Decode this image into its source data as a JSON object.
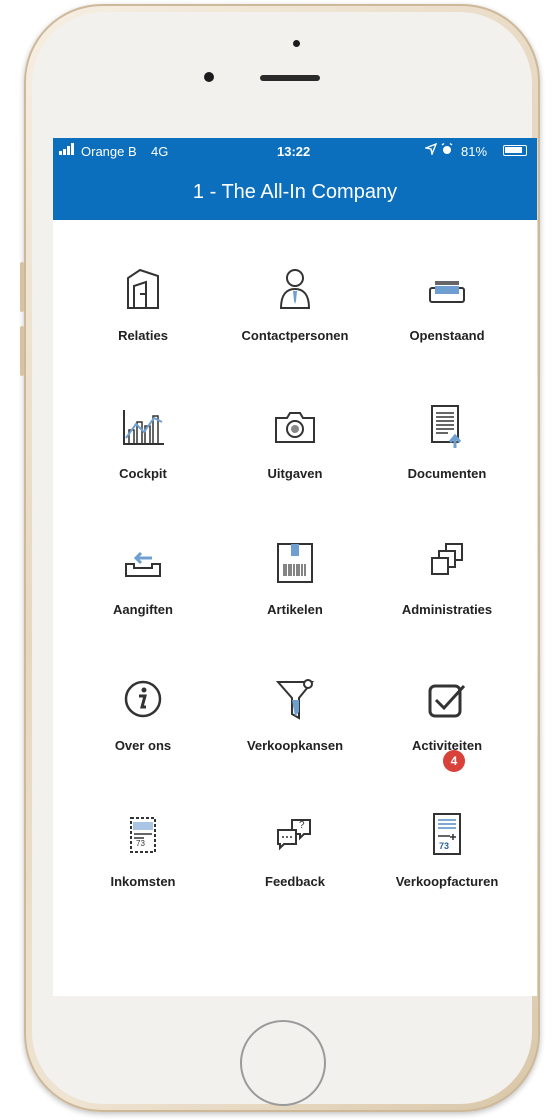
{
  "status": {
    "carrier": "Orange B",
    "network": "4G",
    "time": "13:22",
    "battery": "81%"
  },
  "header": {
    "title": "1 - The All-In Company"
  },
  "menu": [
    {
      "label": "Relaties",
      "icon": "building-icon"
    },
    {
      "label": "Contactpersonen",
      "icon": "person-icon"
    },
    {
      "label": "Openstaand",
      "icon": "tray-stack-icon"
    },
    {
      "label": "Cockpit",
      "icon": "chart-icon"
    },
    {
      "label": "Uitgaven",
      "icon": "camera-icon"
    },
    {
      "label": "Documenten",
      "icon": "document-upload-icon"
    },
    {
      "label": "Aangiften",
      "icon": "outbox-icon"
    },
    {
      "label": "Artikelen",
      "icon": "barcode-icon"
    },
    {
      "label": "Administraties",
      "icon": "stacked-pages-icon"
    },
    {
      "label": "Over ons",
      "icon": "info-icon"
    },
    {
      "label": "Verkoopkansen",
      "icon": "funnel-icon"
    },
    {
      "label": "Activiteiten",
      "icon": "checkbox-icon",
      "badge": "4"
    },
    {
      "label": "Inkomsten",
      "icon": "receipt-icon",
      "icon_text": "73"
    },
    {
      "label": "Feedback",
      "icon": "chat-bubbles-icon",
      "icon_text": "?"
    },
    {
      "label": "Verkoopfacturen",
      "icon": "invoice-icon",
      "icon_text": "73"
    }
  ],
  "colors": {
    "accent": "#0b6fbd",
    "icon_blue": "#6f9fd0",
    "badge": "#d9413b"
  }
}
